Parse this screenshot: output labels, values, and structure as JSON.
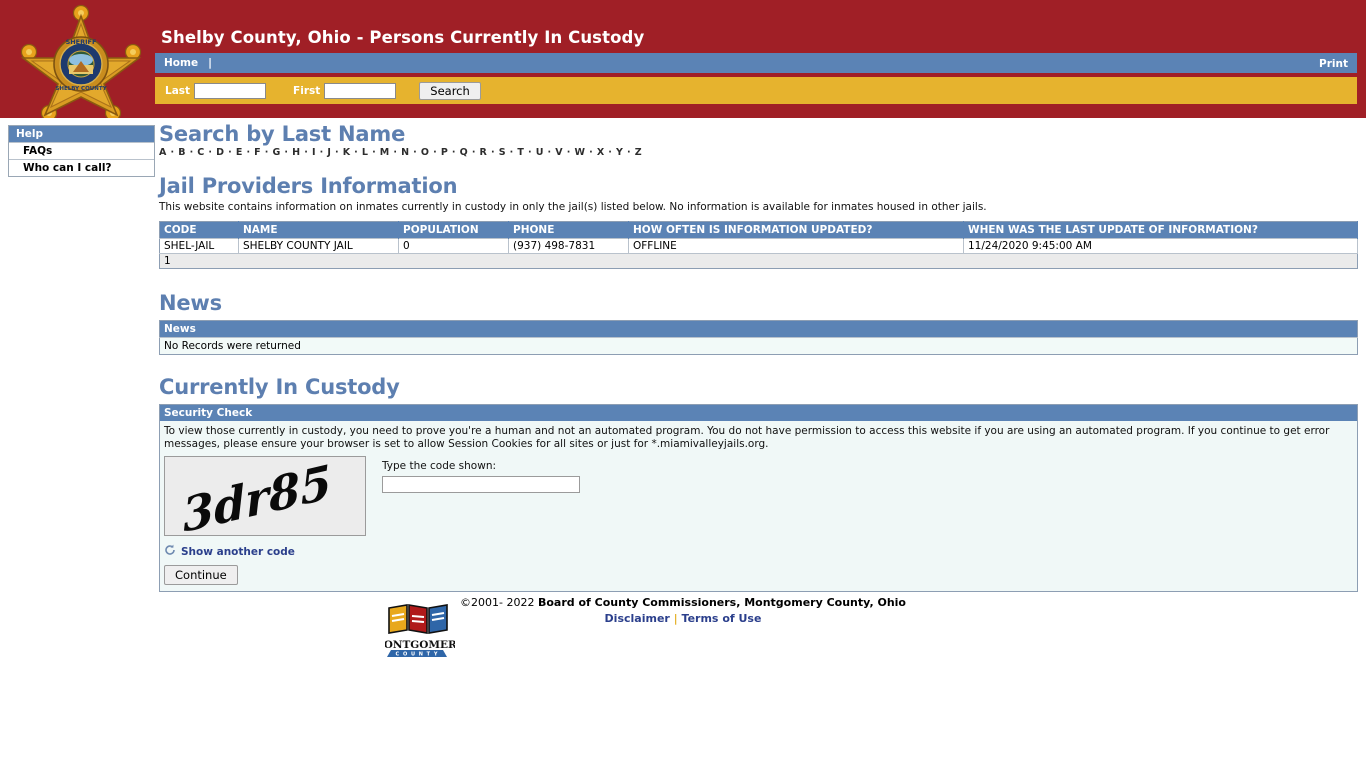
{
  "header": {
    "title": "Shelby County, Ohio - Persons Currently In Custody",
    "badge_alt": "sheriff-star-badge",
    "nav": {
      "home": "Home",
      "separator": "|",
      "print": "Print"
    },
    "search": {
      "last_label": "Last",
      "last_value": "",
      "first_label": "First",
      "first_value": "",
      "button": "Search"
    },
    "colors": {
      "banner_red": "#a01f26",
      "nav_blue": "#5b83b5",
      "gold": "#e6b32e"
    }
  },
  "sidebar": {
    "heading": "Help",
    "items": [
      {
        "label": "FAQs"
      },
      {
        "label": "Who can I call?"
      }
    ]
  },
  "search_by_last_name": {
    "heading": "Search by Last Name",
    "letters": [
      "A",
      "B",
      "C",
      "D",
      "E",
      "F",
      "G",
      "H",
      "I",
      "J",
      "K",
      "L",
      "M",
      "N",
      "O",
      "P",
      "Q",
      "R",
      "S",
      "T",
      "U",
      "V",
      "W",
      "X",
      "Y",
      "Z"
    ]
  },
  "jail_providers": {
    "heading": "Jail Providers Information",
    "blurb": "This website contains information on inmates currently in custody in only the jail(s) listed below. No information is available for inmates housed in other jails.",
    "columns": [
      "CODE",
      "NAME",
      "POPULATION",
      "PHONE",
      "HOW OFTEN IS INFORMATION UPDATED?",
      "WHEN WAS THE LAST UPDATE OF INFORMATION?"
    ],
    "rows": [
      [
        "SHEL-JAIL",
        "SHELBY COUNTY JAIL",
        "0",
        "(937) 498-7831",
        "OFFLINE",
        "11/24/2020 9:45:00 AM"
      ]
    ],
    "pager": "1"
  },
  "news": {
    "heading": "News",
    "column": "News",
    "empty_message": "No Records were returned"
  },
  "custody": {
    "heading": "Currently In Custody",
    "security_check": {
      "panel_title": "Security Check",
      "paragraph": "To view those currently in custody, you need to prove you're a human and not an automated program. You do not have permission to access this website if you are using an automated program. If you continue to get error messages, please ensure your browser is set to allow Session Cookies for all sites or just for *.miamivalleyjails.org.",
      "captcha_code": "3dr85",
      "code_label": "Type the code shown:",
      "code_value": "",
      "refresh_label": "Show another code",
      "continue_label": "Continue"
    }
  },
  "footer": {
    "copyright_prefix": "©2001- 2022",
    "copyright_org": "Board of County Commissioners, Montgomery County, Ohio",
    "disclaimer": "Disclaimer",
    "pipe": "|",
    "terms": "Terms of Use",
    "logo_title": "MONTGOMERY",
    "logo_subtitle": "C O U N T Y"
  }
}
